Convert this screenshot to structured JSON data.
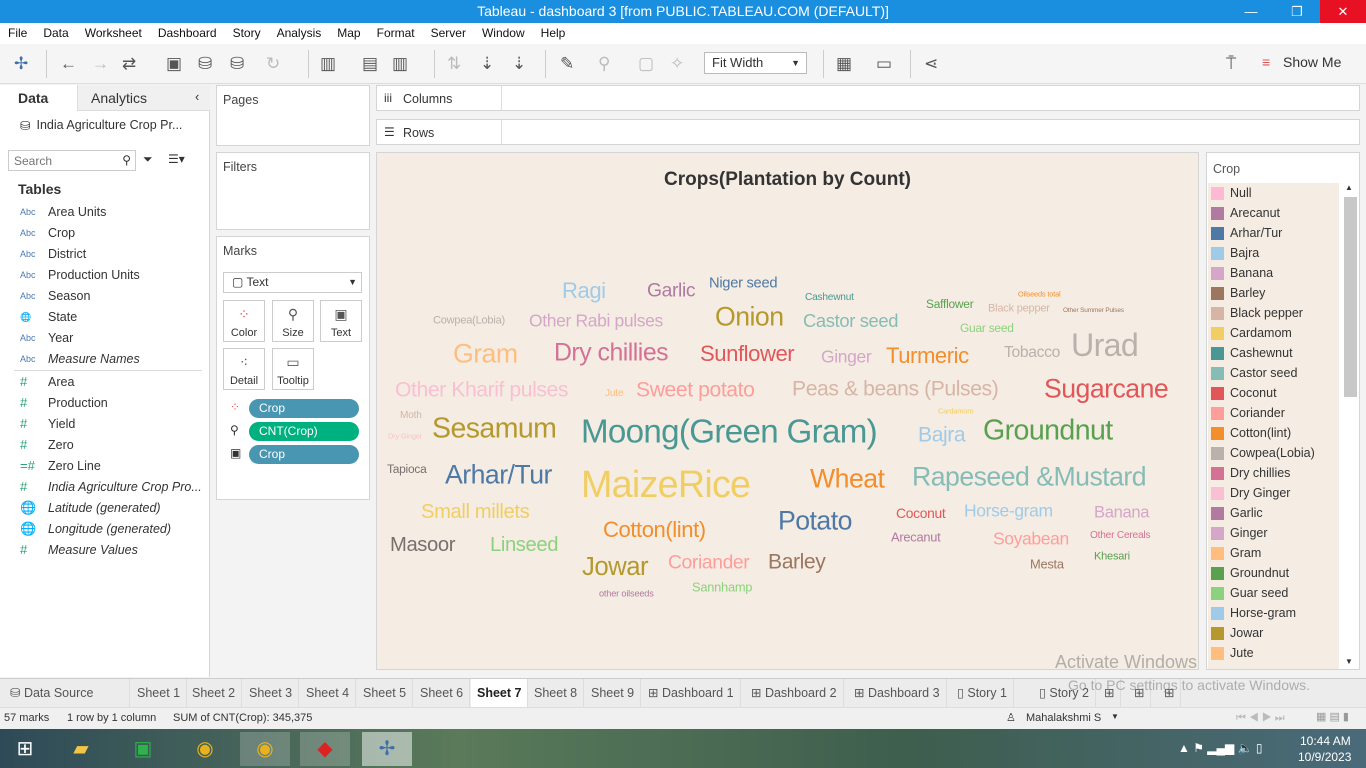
{
  "window": {
    "title": "Tableau - dashboard 3 [from PUBLIC.TABLEAU.COM (DEFAULT)]",
    "min": "—",
    "restore": "❐",
    "close": "✕"
  },
  "menu": [
    "File",
    "Data",
    "Worksheet",
    "Dashboard",
    "Story",
    "Analysis",
    "Map",
    "Format",
    "Server",
    "Window",
    "Help"
  ],
  "toolbar": {
    "fit": "Fit Width",
    "show_me": "Show Me"
  },
  "left": {
    "tab_data": "Data",
    "tab_analytics": "Analytics",
    "datasource": "India Agriculture Crop Pr...",
    "search_placeholder": "Search",
    "tables_label": "Tables",
    "dimensions": [
      "Area Units",
      "Crop",
      "District",
      "Production Units",
      "Season",
      "State",
      "Year",
      "Measure Names"
    ],
    "measures": [
      "Area",
      "Production",
      "Yield",
      "Zero",
      "Zero Line",
      "India Agriculture Crop Pro...",
      "Latitude (generated)",
      "Longitude (generated)",
      "Measure Values"
    ]
  },
  "shelves": {
    "pages": "Pages",
    "filters": "Filters",
    "marks": "Marks",
    "columns": "Columns",
    "rows": "Rows",
    "mark_type": "Text",
    "buttons": [
      "Color",
      "Size",
      "Text",
      "Detail",
      "Tooltip"
    ],
    "pills": [
      "Crop",
      "CNT(Crop)",
      "Crop"
    ]
  },
  "viz": {
    "title": "Crops(Plantation by Count)",
    "words": [
      {
        "t": "Ragi",
        "c": "#a0cbe8"
      },
      {
        "t": "Garlic",
        "c": "#b07aa1"
      },
      {
        "t": "Niger seed",
        "c": "#4e79a7"
      },
      {
        "t": "Cashewnut",
        "c": "#499894"
      },
      {
        "t": "Safflower",
        "c": "#59a14f"
      },
      {
        "t": "Black pepper",
        "c": "#d7b5a6"
      },
      {
        "t": "Oilseeds total",
        "c": "#f28e2b"
      },
      {
        "t": "Other Summer Pulses",
        "c": "#9d7660"
      },
      {
        "t": "Cowpea(Lobia)",
        "c": "#bab0ac"
      },
      {
        "t": "Other Rabi pulses",
        "c": "#d4a6c8"
      },
      {
        "t": "Onion",
        "c": "#b6992d"
      },
      {
        "t": "Castor seed",
        "c": "#86bcb6"
      },
      {
        "t": "Guar seed",
        "c": "#8cd17d"
      },
      {
        "t": "Gram",
        "c": "#ffbe7d"
      },
      {
        "t": "Dry chillies",
        "c": "#d37295"
      },
      {
        "t": "Sunflower",
        "c": "#e15759"
      },
      {
        "t": "Ginger",
        "c": "#d4a6c8"
      },
      {
        "t": "Turmeric",
        "c": "#f28e2b"
      },
      {
        "t": "Tobacco",
        "c": "#bab0ac"
      },
      {
        "t": "Urad",
        "c": "#bab0ac"
      },
      {
        "t": "Other Kharif pulses",
        "c": "#fabfd2"
      },
      {
        "t": "Jute",
        "c": "#ffbe7d"
      },
      {
        "t": "Sweet potato",
        "c": "#ff9d9a"
      },
      {
        "t": "Peas & beans (Pulses)",
        "c": "#d7b5a6"
      },
      {
        "t": "Sugarcane",
        "c": "#e15759"
      },
      {
        "t": "Moth",
        "c": "#d7b5a6"
      },
      {
        "t": "Cardamom",
        "c": "#f1ce63"
      },
      {
        "t": "Dry Ginger",
        "c": "#fabfd2"
      },
      {
        "t": "Sesamum",
        "c": "#b6992d"
      },
      {
        "t": "Moong(Green Gram)",
        "c": "#499894"
      },
      {
        "t": "Bajra",
        "c": "#a0cbe8"
      },
      {
        "t": "Groundnut",
        "c": "#59a14f"
      },
      {
        "t": "Tapioca",
        "c": "#79706e"
      },
      {
        "t": "Arhar/Tur",
        "c": "#4e79a7"
      },
      {
        "t": "MaizeRice",
        "c": "#f1ce63"
      },
      {
        "t": "Wheat",
        "c": "#f28e2b"
      },
      {
        "t": "Rapeseed &Mustard",
        "c": "#86bcb6"
      },
      {
        "t": "Small millets",
        "c": "#f1ce63"
      },
      {
        "t": "Potato",
        "c": "#4e79a7"
      },
      {
        "t": "Coconut",
        "c": "#e15759"
      },
      {
        "t": "Horse-gram",
        "c": "#a0cbe8"
      },
      {
        "t": "Banana",
        "c": "#d4a6c8"
      },
      {
        "t": "Cotton(lint)",
        "c": "#f28e2b"
      },
      {
        "t": "Arecanut",
        "c": "#b07aa1"
      },
      {
        "t": "Soyabean",
        "c": "#ff9d9a"
      },
      {
        "t": "Other Cereals",
        "c": "#d37295"
      },
      {
        "t": "Masoor",
        "c": "#79706e"
      },
      {
        "t": "Linseed",
        "c": "#8cd17d"
      },
      {
        "t": "Jowar",
        "c": "#b6992d"
      },
      {
        "t": "Coriander",
        "c": "#ff9d9a"
      },
      {
        "t": "Barley",
        "c": "#9d7660"
      },
      {
        "t": "Mesta",
        "c": "#9d7660"
      },
      {
        "t": "Khesari",
        "c": "#59a14f"
      },
      {
        "t": "other oilseeds",
        "c": "#b07aa1"
      },
      {
        "t": "Sannhamp",
        "c": "#8cd17d"
      }
    ]
  },
  "legend": {
    "title": "Crop",
    "items": [
      {
        "l": "Null",
        "c": "#ffb9d5"
      },
      {
        "l": "Arecanut",
        "c": "#b07aa1"
      },
      {
        "l": "Arhar/Tur",
        "c": "#4e79a7"
      },
      {
        "l": "Bajra",
        "c": "#a0cbe8"
      },
      {
        "l": "Banana",
        "c": "#d4a6c8"
      },
      {
        "l": "Barley",
        "c": "#9d7660"
      },
      {
        "l": "Black pepper",
        "c": "#d7b5a6"
      },
      {
        "l": "Cardamom",
        "c": "#f1ce63"
      },
      {
        "l": "Cashewnut",
        "c": "#499894"
      },
      {
        "l": "Castor seed",
        "c": "#86bcb6"
      },
      {
        "l": "Coconut",
        "c": "#e15759"
      },
      {
        "l": "Coriander",
        "c": "#ff9d9a"
      },
      {
        "l": "Cotton(lint)",
        "c": "#f28e2b"
      },
      {
        "l": "Cowpea(Lobia)",
        "c": "#bab0ac"
      },
      {
        "l": "Dry chillies",
        "c": "#d37295"
      },
      {
        "l": "Dry Ginger",
        "c": "#fabfd2"
      },
      {
        "l": "Garlic",
        "c": "#b07aa1"
      },
      {
        "l": "Ginger",
        "c": "#d4a6c8"
      },
      {
        "l": "Gram",
        "c": "#ffbe7d"
      },
      {
        "l": "Groundnut",
        "c": "#59a14f"
      },
      {
        "l": "Guar seed",
        "c": "#8cd17d"
      },
      {
        "l": "Horse-gram",
        "c": "#a0cbe8"
      },
      {
        "l": "Jowar",
        "c": "#b6992d"
      },
      {
        "l": "Jute",
        "c": "#ffbe7d"
      }
    ]
  },
  "tabs": {
    "data_source": "Data Source",
    "sheets": [
      "Sheet 1",
      "Sheet 2",
      "Sheet 3",
      "Sheet 4",
      "Sheet 5",
      "Sheet 6",
      "Sheet 7",
      "Sheet 8",
      "Sheet 9",
      "Dashboard 1",
      "Dashboard 2",
      "Dashboard 3",
      "Story 1",
      "Story 2"
    ],
    "active": "Sheet 7"
  },
  "status": {
    "marks": "57 marks",
    "rows": "1 row by 1 column",
    "sum": "SUM of CNT(Crop): 345,375",
    "user": "Mahalakshmi S"
  },
  "watermark": {
    "line1": "Activate Windows",
    "line2": "Go to PC settings to activate Windows."
  },
  "taskbar": {
    "time": "10:44 AM",
    "date": "10/9/2023"
  }
}
